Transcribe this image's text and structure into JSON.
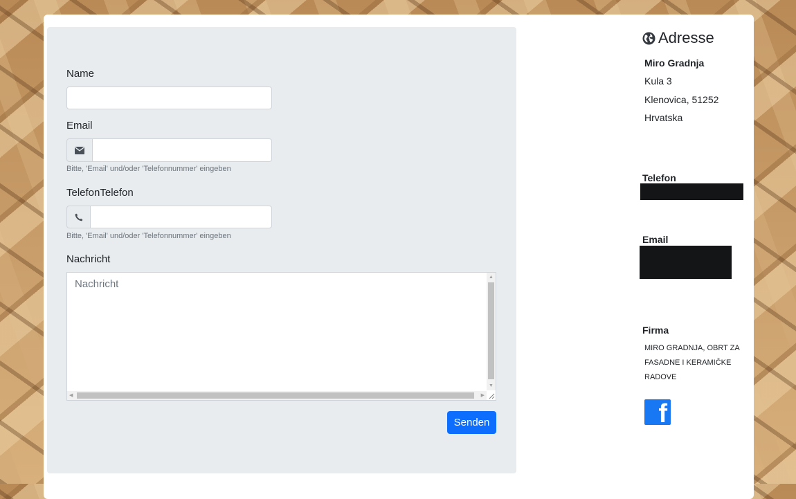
{
  "form": {
    "name_label": "Name",
    "email_label": "Email",
    "email_help": "Bitte, 'Email' und/oder 'Telefonnummer' eingeben",
    "phone_label": "TelefonTelefon",
    "phone_help": "Bitte, 'Email' und/oder 'Telefonnummer' eingeben",
    "message_label": "Nachricht",
    "message_placeholder": "Nachricht",
    "submit_label": "Senden"
  },
  "sidebar": {
    "address_title": "Adresse",
    "address_icon": "globe-icon",
    "address_name": "Miro Gradnja",
    "address_street": "Kula 3",
    "address_city": "Klenovica, 51252",
    "address_country": "Hrvatska",
    "phone_title": "Telefon",
    "email_title": "Email",
    "company_title": "Firma",
    "company_name": "MIRO GRADNJA, OBRT ZA FASADNE I KERAMIČKE RADOVE",
    "social_icon": "facebook-icon",
    "social_glyph": "f"
  },
  "colors": {
    "primary": "#0d6efd",
    "panel": "#e9ecef",
    "facebook": "#1877f2",
    "redaction": "#141517"
  }
}
